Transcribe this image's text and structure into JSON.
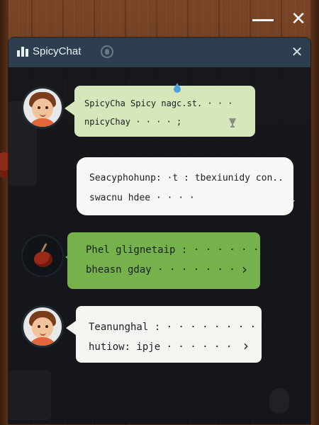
{
  "window": {
    "minimize_icon": "minimize-icon",
    "close_glyph": "✕"
  },
  "titlebar": {
    "title": "SpicyChat",
    "app_icon": "bar-chart-icon",
    "status_icon": "status-icon",
    "close_glyph": "✕"
  },
  "messages": [
    {
      "sender": "user",
      "avatar": "boy-avatar",
      "lines": [
        "SpicyCha Spicy nagc.st. · · ·",
        "npicyChay · · · · ;"
      ],
      "color": "#d7e6bb"
    },
    {
      "sender": "bot",
      "lines": [
        "Seacyphohunp: ·t : tbexiunidy con..",
        "swacnu hdee · · · ·"
      ],
      "color": "#f7f7f5"
    },
    {
      "sender": "fruit",
      "avatar": "fruit-avatar",
      "lines": [
        "Phel glignetaip : · · · · · ·",
        "bheasn gday · · · · · · ·"
      ],
      "color": "#75b24c"
    },
    {
      "sender": "user",
      "avatar": "boy-avatar",
      "lines": [
        "Teanunghal : · · · · · · · · ·",
        "hutiow: ipje · · · · · ·"
      ],
      "color": "#f4f4f1"
    }
  ],
  "chevron_glyph": "›"
}
